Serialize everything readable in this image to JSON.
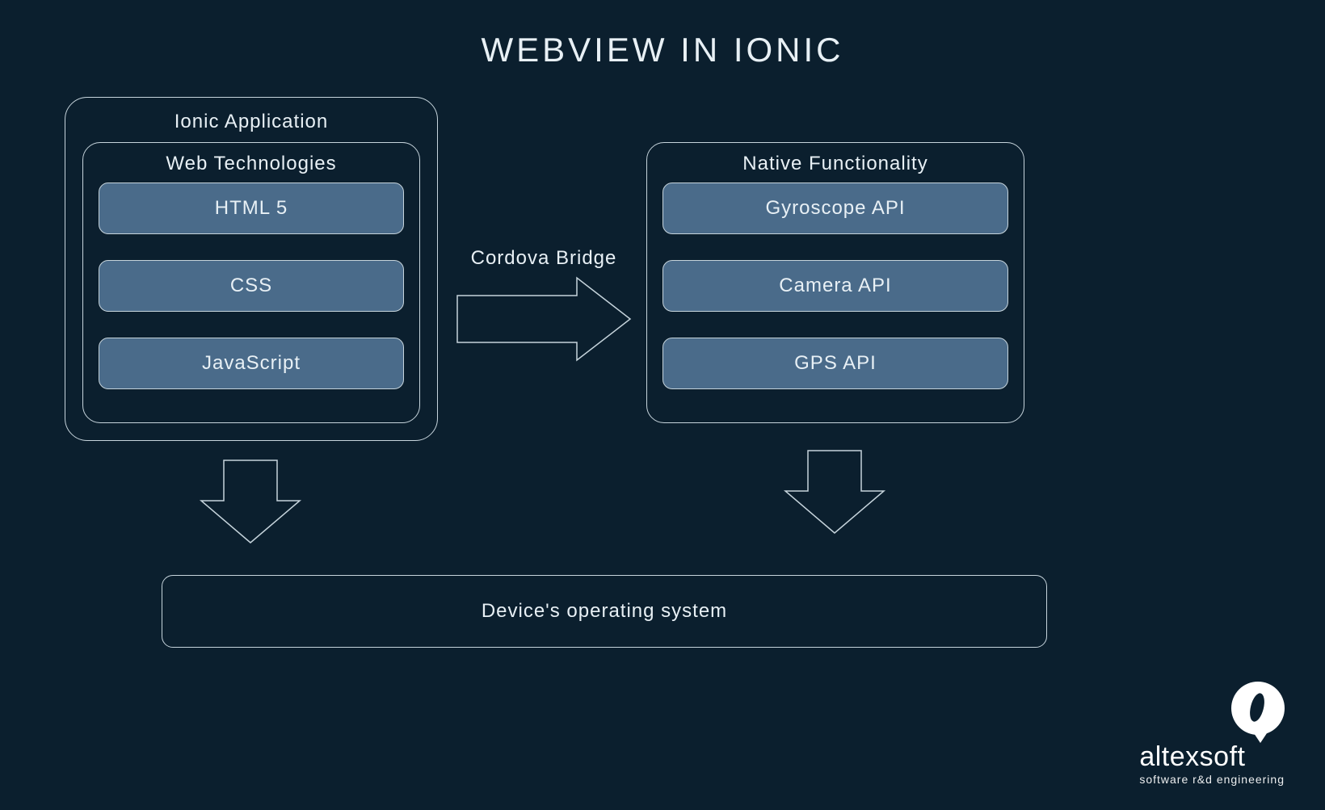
{
  "title": "WEBVIEW IN IONIC",
  "ionic_app": {
    "label": "Ionic Application",
    "web_tech": {
      "label": "Web Technologies",
      "items": [
        "HTML 5",
        "CSS",
        "JavaScript"
      ]
    }
  },
  "bridge_label": "Cordova Bridge",
  "native": {
    "label": "Native Functionality",
    "items": [
      "Gyroscope API",
      "Camera API",
      "GPS API"
    ]
  },
  "os_label": "Device's operating system",
  "logo": {
    "name": "altexsoft",
    "tagline": "software r&d engineering"
  }
}
